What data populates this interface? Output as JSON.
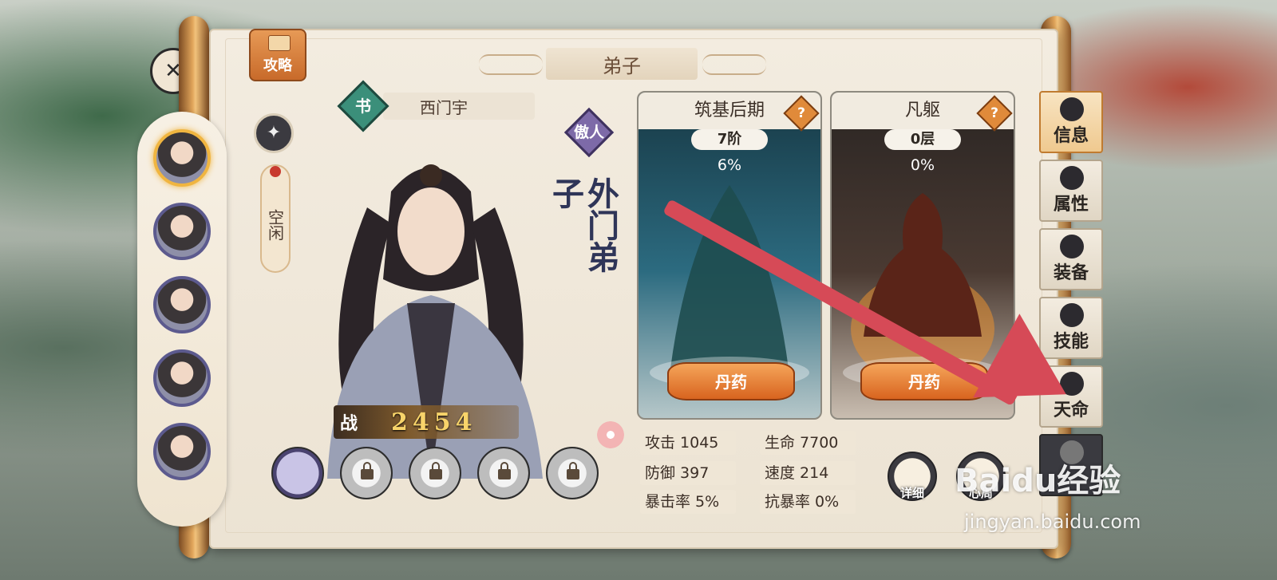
{
  "header": {
    "guide_label": "攻略",
    "title": "弟子"
  },
  "disciple": {
    "name": "西门宇",
    "book_badge": "书",
    "trait": "傲人",
    "status": "空闲",
    "rank": "外门弟子",
    "power_label": "战",
    "power_value": "2454"
  },
  "realms": [
    {
      "title": "筑基后期",
      "level": "7阶",
      "progress": "6%",
      "button": "丹药"
    },
    {
      "title": "凡躯",
      "level": "0层",
      "progress": "0%",
      "button": "丹药"
    }
  ],
  "stats": [
    {
      "label": "攻击",
      "value": "1045"
    },
    {
      "label": "生命",
      "value": "7700"
    },
    {
      "label": "防御",
      "value": "397"
    },
    {
      "label": "速度",
      "value": "214"
    },
    {
      "label": "暴击率",
      "value": "5%"
    },
    {
      "label": "抗暴率",
      "value": "0%"
    }
  ],
  "tools": {
    "detail": "详细",
    "second": "心周"
  },
  "side_tabs": [
    "信息",
    "属性",
    "装备",
    "技能",
    "天命"
  ],
  "watermark": {
    "main": "Baidu经验",
    "sub": "jingyan.baidu.com"
  },
  "help_glyph": "?",
  "colors": {
    "arrow": "#d64a57",
    "accent_orange": "#e08a3a",
    "selected_ring": "#f0b540"
  }
}
